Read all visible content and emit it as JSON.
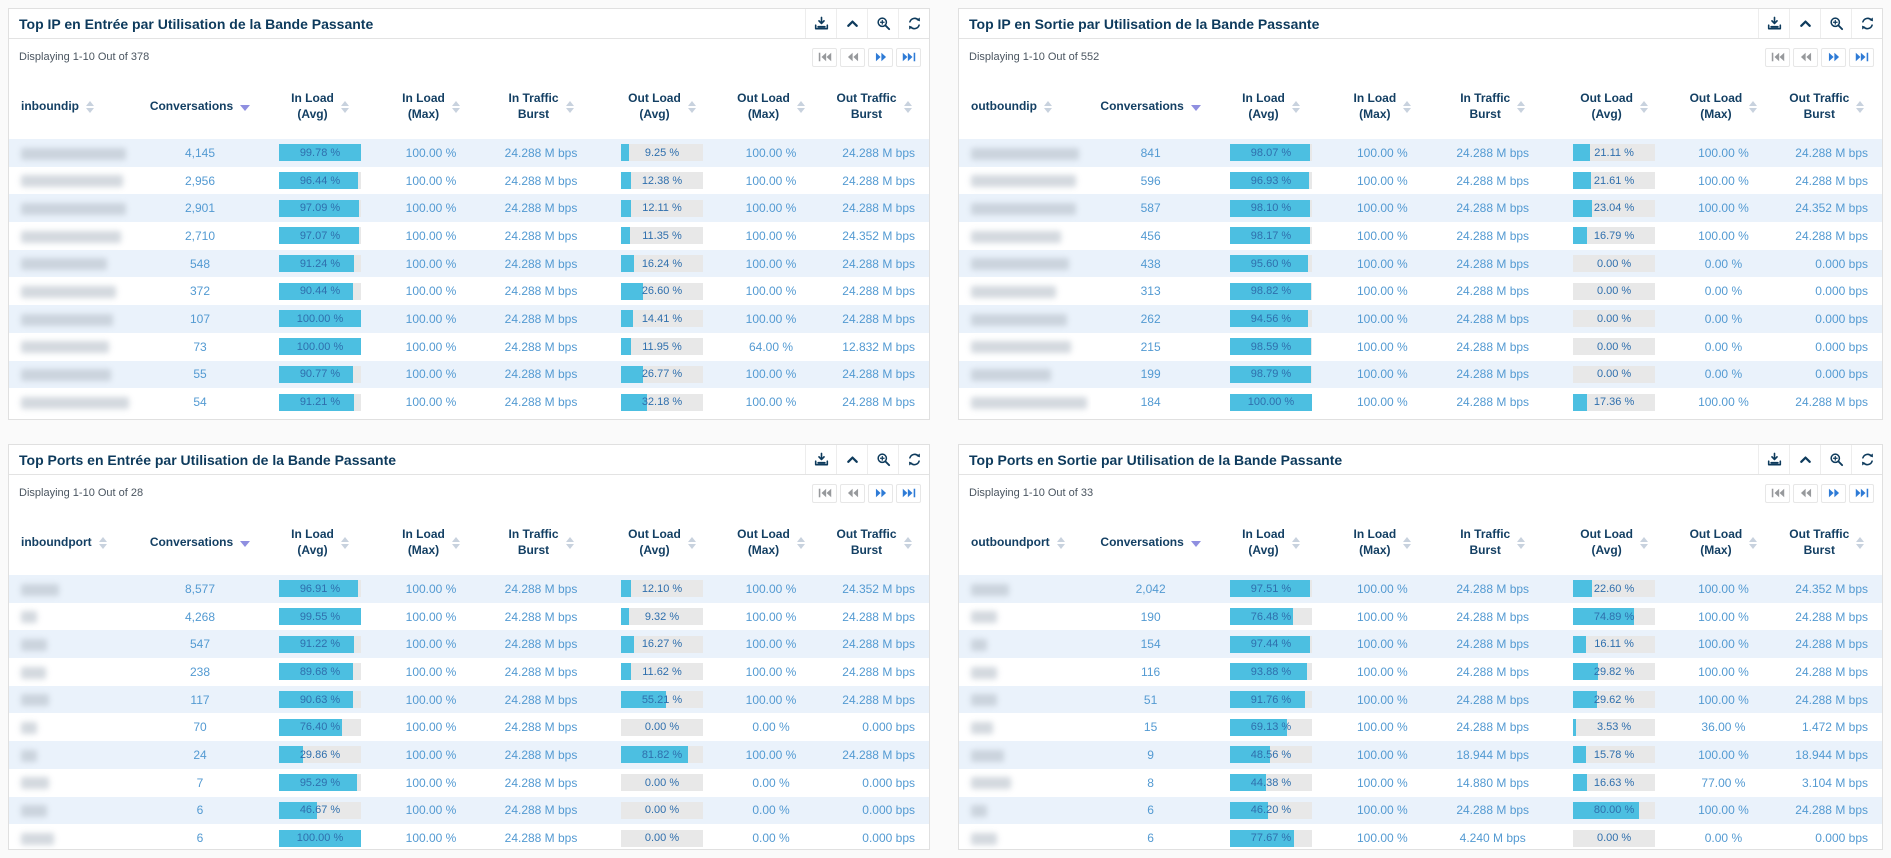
{
  "colors": {
    "title_navy": "#0d3a5c",
    "header_navy": "#133f63",
    "data_blue": "#539ad2",
    "bar_fill_cyan": "#4cbfe1",
    "bar_track_gray": "#e8e8e8",
    "bar_label_blue": "#2f6fad",
    "alt_row_blue": "#eaf2fb",
    "pager_active_blue": "#2e7bd6",
    "pager_inactive_gray": "#97999c",
    "sort_active_purple": "#8f8fe0"
  },
  "icons": {
    "toolbar": [
      "export-icon",
      "collapse-icon",
      "zoom-icon",
      "refresh-icon"
    ],
    "pager": [
      "pager-first-icon",
      "pager-prev-icon",
      "pager-next-icon",
      "pager-last-icon"
    ]
  },
  "row_fields": [
    "key_redacted_width_px",
    "conversations",
    "in_load_avg_pct",
    "in_load_max",
    "in_traffic_burst",
    "out_load_avg_pct",
    "out_load_max",
    "out_traffic_burst"
  ],
  "key_note": "first-column values are blurred/redacted in the screenshot",
  "panels": [
    {
      "title": "Top IP en Entrée par Utilisation de la Bande Passante",
      "displaying": "Displaying 1-10 Out of 378",
      "columns": [
        {
          "lines": [
            "inboundip"
          ],
          "sort": "both"
        },
        {
          "lines": [
            "Conversations"
          ],
          "sort": "desc"
        },
        {
          "lines": [
            "In Load",
            "(Avg)"
          ],
          "sort": "both"
        },
        {
          "lines": [
            "In Load",
            "(Max)"
          ],
          "sort": "both"
        },
        {
          "lines": [
            "In Traffic",
            "Burst"
          ],
          "sort": "both"
        },
        {
          "lines": [
            "Out Load",
            "(Avg)"
          ],
          "sort": "both"
        },
        {
          "lines": [
            "Out Load",
            "(Max)"
          ],
          "sort": "both"
        },
        {
          "lines": [
            "Out Traffic",
            "Burst"
          ],
          "sort": "both"
        }
      ],
      "rows": [
        [
          105,
          "4,145",
          99.78,
          "100.00 %",
          "24.288 M bps",
          9.25,
          "100.00 %",
          "24.288 M bps"
        ],
        [
          102,
          "2,956",
          96.44,
          "100.00 %",
          "24.288 M bps",
          12.38,
          "100.00 %",
          "24.288 M bps"
        ],
        [
          105,
          "2,901",
          97.09,
          "100.00 %",
          "24.288 M bps",
          12.11,
          "100.00 %",
          "24.288 M bps"
        ],
        [
          100,
          "2,710",
          97.07,
          "100.00 %",
          "24.288 M bps",
          11.35,
          "100.00 %",
          "24.352 M bps"
        ],
        [
          86,
          "548",
          91.24,
          "100.00 %",
          "24.288 M bps",
          16.24,
          "100.00 %",
          "24.288 M bps"
        ],
        [
          95,
          "372",
          90.44,
          "100.00 %",
          "24.288 M bps",
          26.6,
          "100.00 %",
          "24.288 M bps"
        ],
        [
          92,
          "107",
          100.0,
          "100.00 %",
          "24.288 M bps",
          14.41,
          "100.00 %",
          "24.288 M bps"
        ],
        [
          88,
          "73",
          100.0,
          "100.00 %",
          "24.288 M bps",
          11.95,
          "64.00 %",
          "12.832 M bps"
        ],
        [
          90,
          "55",
          90.77,
          "100.00 %",
          "24.288 M bps",
          26.77,
          "100.00 %",
          "24.288 M bps"
        ],
        [
          108,
          "54",
          91.21,
          "100.00 %",
          "24.288 M bps",
          32.18,
          "100.00 %",
          "24.288 M bps"
        ]
      ]
    },
    {
      "title": "Top IP en Sortie par Utilisation de la Bande Passante",
      "displaying": "Displaying 1-10 Out of 552",
      "columns": [
        {
          "lines": [
            "outboundip"
          ],
          "sort": "both"
        },
        {
          "lines": [
            "Conversations"
          ],
          "sort": "desc"
        },
        {
          "lines": [
            "In Load",
            "(Avg)"
          ],
          "sort": "both"
        },
        {
          "lines": [
            "In Load",
            "(Max)"
          ],
          "sort": "both"
        },
        {
          "lines": [
            "In Traffic",
            "Burst"
          ],
          "sort": "both"
        },
        {
          "lines": [
            "Out Load",
            "(Avg)"
          ],
          "sort": "both"
        },
        {
          "lines": [
            "Out Load",
            "(Max)"
          ],
          "sort": "both"
        },
        {
          "lines": [
            "Out Traffic",
            "Burst"
          ],
          "sort": "both"
        }
      ],
      "rows": [
        [
          108,
          "841",
          98.07,
          "100.00 %",
          "24.288 M bps",
          21.11,
          "100.00 %",
          "24.288 M bps"
        ],
        [
          105,
          "596",
          96.93,
          "100.00 %",
          "24.288 M bps",
          21.61,
          "100.00 %",
          "24.288 M bps"
        ],
        [
          105,
          "587",
          98.1,
          "100.00 %",
          "24.288 M bps",
          23.04,
          "100.00 %",
          "24.352 M bps"
        ],
        [
          90,
          "456",
          98.17,
          "100.00 %",
          "24.288 M bps",
          16.79,
          "100.00 %",
          "24.288 M bps"
        ],
        [
          98,
          "438",
          95.6,
          "100.00 %",
          "24.288 M bps",
          0.0,
          "0.00 %",
          "0.000 bps"
        ],
        [
          85,
          "313",
          98.82,
          "100.00 %",
          "24.288 M bps",
          0.0,
          "0.00 %",
          "0.000 bps"
        ],
        [
          96,
          "262",
          94.56,
          "100.00 %",
          "24.288 M bps",
          0.0,
          "0.00 %",
          "0.000 bps"
        ],
        [
          100,
          "215",
          98.59,
          "100.00 %",
          "24.288 M bps",
          0.0,
          "0.00 %",
          "0.000 bps"
        ],
        [
          80,
          "199",
          98.79,
          "100.00 %",
          "24.288 M bps",
          0.0,
          "0.00 %",
          "0.000 bps"
        ],
        [
          116,
          "184",
          100.0,
          "100.00 %",
          "24.288 M bps",
          17.36,
          "100.00 %",
          "24.288 M bps"
        ]
      ]
    },
    {
      "title": "Top Ports en Entrée par Utilisation de la Bande Passante",
      "displaying": "Displaying 1-10 Out of 28",
      "columns": [
        {
          "lines": [
            "inboundport"
          ],
          "sort": "both"
        },
        {
          "lines": [
            "Conversations"
          ],
          "sort": "desc"
        },
        {
          "lines": [
            "In Load",
            "(Avg)"
          ],
          "sort": "both"
        },
        {
          "lines": [
            "In Load",
            "(Max)"
          ],
          "sort": "both"
        },
        {
          "lines": [
            "In Traffic",
            "Burst"
          ],
          "sort": "both"
        },
        {
          "lines": [
            "Out Load",
            "(Avg)"
          ],
          "sort": "both"
        },
        {
          "lines": [
            "Out Load",
            "(Max)"
          ],
          "sort": "both"
        },
        {
          "lines": [
            "Out Traffic",
            "Burst"
          ],
          "sort": "both"
        }
      ],
      "rows": [
        [
          38,
          "8,577",
          96.91,
          "100.00 %",
          "24.288 M bps",
          12.1,
          "100.00 %",
          "24.352 M bps"
        ],
        [
          16,
          "4,268",
          99.55,
          "100.00 %",
          "24.288 M bps",
          9.32,
          "100.00 %",
          "24.288 M bps"
        ],
        [
          26,
          "547",
          91.22,
          "100.00 %",
          "24.288 M bps",
          16.27,
          "100.00 %",
          "24.288 M bps"
        ],
        [
          25,
          "238",
          89.68,
          "100.00 %",
          "24.288 M bps",
          11.62,
          "100.00 %",
          "24.288 M bps"
        ],
        [
          28,
          "117",
          90.63,
          "100.00 %",
          "24.288 M bps",
          55.21,
          "100.00 %",
          "24.288 M bps"
        ],
        [
          16,
          "70",
          76.4,
          "100.00 %",
          "24.288 M bps",
          0.0,
          "0.00 %",
          "0.000 bps"
        ],
        [
          16,
          "24",
          29.86,
          "100.00 %",
          "24.288 M bps",
          81.82,
          "100.00 %",
          "24.288 M bps"
        ],
        [
          28,
          "7",
          95.29,
          "100.00 %",
          "24.288 M bps",
          0.0,
          "0.00 %",
          "0.000 bps"
        ],
        [
          26,
          "6",
          46.67,
          "100.00 %",
          "24.288 M bps",
          0.0,
          "0.00 %",
          "0.000 bps"
        ],
        [
          33,
          "6",
          100.0,
          "100.00 %",
          "24.288 M bps",
          0.0,
          "0.00 %",
          "0.000 bps"
        ]
      ]
    },
    {
      "title": "Top Ports en Sortie par Utilisation de la Bande Passante",
      "displaying": "Displaying 1-10 Out of 33",
      "columns": [
        {
          "lines": [
            "outboundport"
          ],
          "sort": "both"
        },
        {
          "lines": [
            "Conversations"
          ],
          "sort": "desc"
        },
        {
          "lines": [
            "In Load",
            "(Avg)"
          ],
          "sort": "both"
        },
        {
          "lines": [
            "In Load",
            "(Max)"
          ],
          "sort": "both"
        },
        {
          "lines": [
            "In Traffic",
            "Burst"
          ],
          "sort": "both"
        },
        {
          "lines": [
            "Out Load",
            "(Avg)"
          ],
          "sort": "both"
        },
        {
          "lines": [
            "Out Load",
            "(Max)"
          ],
          "sort": "both"
        },
        {
          "lines": [
            "Out Traffic",
            "Burst"
          ],
          "sort": "both"
        }
      ],
      "rows": [
        [
          38,
          "2,042",
          97.51,
          "100.00 %",
          "24.288 M bps",
          22.6,
          "100.00 %",
          "24.352 M bps"
        ],
        [
          26,
          "190",
          76.48,
          "100.00 %",
          "24.288 M bps",
          74.89,
          "100.00 %",
          "24.288 M bps"
        ],
        [
          16,
          "154",
          97.44,
          "100.00 %",
          "24.288 M bps",
          16.11,
          "100.00 %",
          "24.288 M bps"
        ],
        [
          26,
          "116",
          93.88,
          "100.00 %",
          "24.288 M bps",
          29.82,
          "100.00 %",
          "24.288 M bps"
        ],
        [
          26,
          "51",
          91.76,
          "100.00 %",
          "24.288 M bps",
          29.62,
          "100.00 %",
          "24.288 M bps"
        ],
        [
          22,
          "15",
          69.13,
          "100.00 %",
          "24.288 M bps",
          3.53,
          "36.00 %",
          "1.472 M bps"
        ],
        [
          33,
          "9",
          48.56,
          "100.00 %",
          "18.944 M bps",
          15.78,
          "100.00 %",
          "18.944 M bps"
        ],
        [
          40,
          "8",
          44.38,
          "100.00 %",
          "14.880 M bps",
          16.63,
          "77.00 %",
          "3.104 M bps"
        ],
        [
          16,
          "6",
          46.2,
          "100.00 %",
          "24.288 M bps",
          80.0,
          "100.00 %",
          "24.288 M bps"
        ],
        [
          26,
          "6",
          77.67,
          "100.00 %",
          "4.240 M bps",
          0.0,
          "0.00 %",
          "0.000 bps"
        ]
      ]
    }
  ]
}
